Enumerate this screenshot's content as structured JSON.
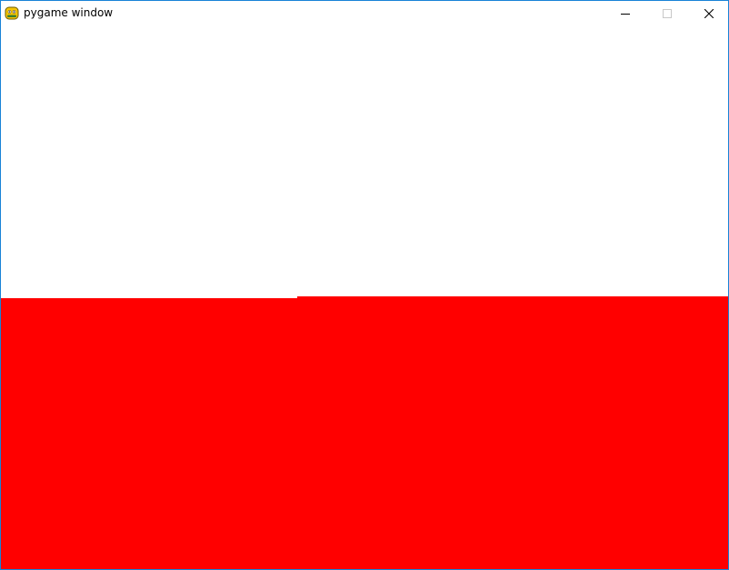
{
  "window": {
    "title": "pygame window",
    "app_icon": "pygame-snake-icon",
    "controls": {
      "minimize_icon": "minimize-icon",
      "maximize_icon": "maximize-icon",
      "close_icon": "close-icon"
    },
    "border_color": "#1883d7"
  },
  "canvas": {
    "background": "#ffffff",
    "shapes": [
      {
        "name": "red-rectangle-left",
        "color": "#ff0000"
      },
      {
        "name": "red-rectangle-right",
        "color": "#ff0000"
      }
    ]
  }
}
